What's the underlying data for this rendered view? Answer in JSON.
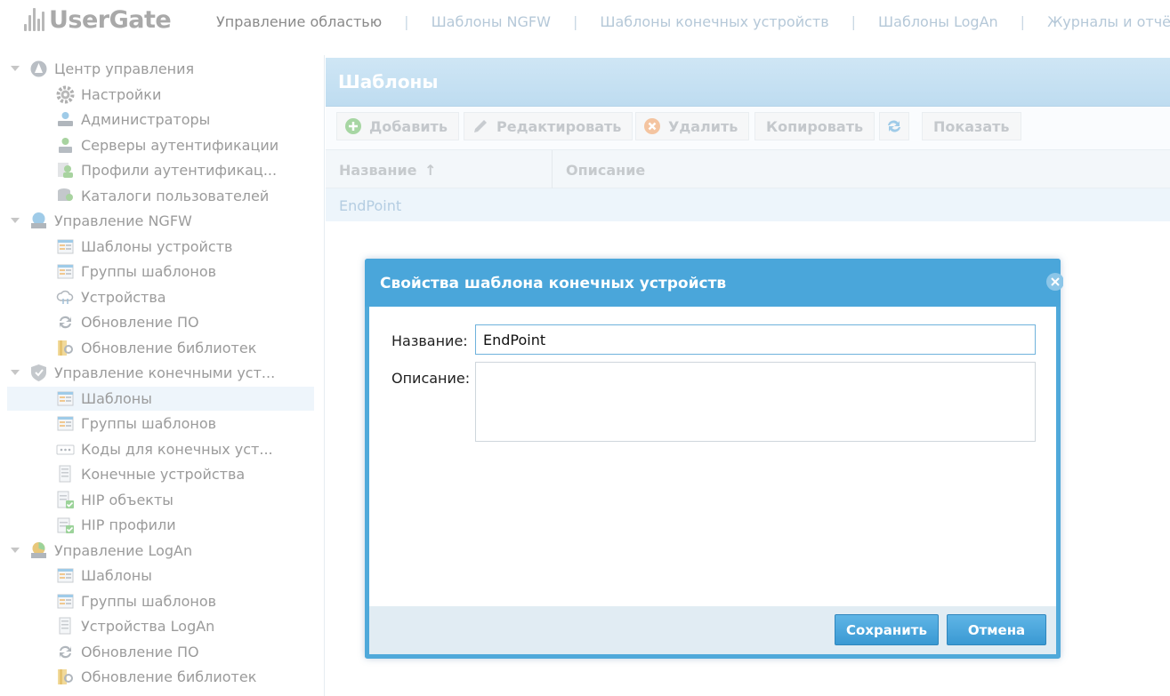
{
  "app": {
    "logo_text": "UserGate"
  },
  "topnav": {
    "items": [
      {
        "label": "Управление областью",
        "active": true
      },
      {
        "label": "Шаблоны NGFW"
      },
      {
        "label": "Шаблоны конечных устройств"
      },
      {
        "label": "Шаблоны LogAn"
      },
      {
        "label": "Журналы и отчёты"
      }
    ],
    "separator": "|"
  },
  "sidebar": {
    "groups": [
      {
        "label": "Центр управления",
        "icon": "control-center-icon",
        "items": [
          {
            "label": "Настройки",
            "icon": "gear-icon"
          },
          {
            "label": "Администраторы",
            "icon": "administrators-icon"
          },
          {
            "label": "Серверы аутентификации",
            "icon": "auth-server-icon"
          },
          {
            "label": "Профили аутентификац...",
            "icon": "auth-profile-icon"
          },
          {
            "label": "Каталоги пользователей",
            "icon": "user-catalog-icon"
          }
        ]
      },
      {
        "label": "Управление NGFW",
        "icon": "ngfw-icon",
        "items": [
          {
            "label": "Шаблоны устройств",
            "icon": "template-icon"
          },
          {
            "label": "Группы шаблонов",
            "icon": "template-group-icon"
          },
          {
            "label": "Устройства",
            "icon": "cloud-devices-icon"
          },
          {
            "label": "Обновление ПО",
            "icon": "refresh-icon"
          },
          {
            "label": "Обновление библиотек",
            "icon": "library-update-icon"
          }
        ]
      },
      {
        "label": "Управление конечными уст...",
        "icon": "endpoint-shield-icon",
        "items": [
          {
            "label": "Шаблоны",
            "icon": "template-icon",
            "selected": true
          },
          {
            "label": "Группы шаблонов",
            "icon": "template-group-icon"
          },
          {
            "label": "Коды для конечных уст...",
            "icon": "codes-icon"
          },
          {
            "label": "Конечные устройства",
            "icon": "endpoint-device-icon"
          },
          {
            "label": "HIP объекты",
            "icon": "hip-object-icon"
          },
          {
            "label": "HIP профили",
            "icon": "hip-profile-icon"
          }
        ]
      },
      {
        "label": "Управление LogAn",
        "icon": "logan-icon",
        "items": [
          {
            "label": "Шаблоны",
            "icon": "template-icon"
          },
          {
            "label": "Группы шаблонов",
            "icon": "template-group-icon"
          },
          {
            "label": "Устройства LogAn",
            "icon": "endpoint-device-icon"
          },
          {
            "label": "Обновление ПО",
            "icon": "refresh-icon"
          },
          {
            "label": "Обновление библиотек",
            "icon": "library-update-icon"
          }
        ]
      }
    ]
  },
  "panel": {
    "title": "Шаблоны",
    "toolbar": {
      "add": "Добавить",
      "edit": "Редактировать",
      "delete": "Удалить",
      "copy": "Копировать",
      "show": "Показать"
    },
    "columns": {
      "name": "Название",
      "description": "Описание",
      "sort_indicator": "↑"
    },
    "rows": [
      {
        "name": "EndPoint",
        "description": ""
      }
    ]
  },
  "dialog": {
    "title": "Свойства шаблона конечных устройств",
    "name_label": "Название:",
    "name_value": "EndPoint",
    "description_label": "Описание:",
    "description_value": "",
    "save_label": "Сохранить",
    "cancel_label": "Отмена"
  },
  "colors": {
    "dialog_header": "#4aa6da",
    "button_blue": "#3a99d3",
    "panel_header": "#c6e0f2",
    "selected_row": "#eef5fb"
  }
}
